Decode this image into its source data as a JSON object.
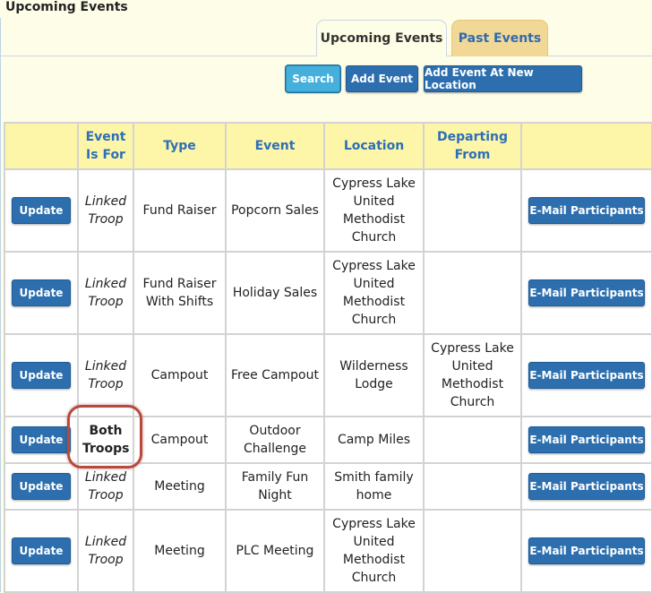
{
  "page": {
    "title": "Upcoming Events"
  },
  "tabs": [
    {
      "label": "Upcoming Events",
      "active": true
    },
    {
      "label": "Past Events",
      "active": false
    }
  ],
  "toolbar": {
    "search_label": "Search",
    "add_event_label": "Add Event",
    "add_event_new_location_label": "Add Event At New Location"
  },
  "table": {
    "headers": {
      "event_is_for": [
        "Event",
        "Is For"
      ],
      "type": "Type",
      "event": "Event",
      "location": "Location",
      "departing_from": [
        "Departing",
        "From"
      ]
    },
    "rows": [
      {
        "update": "Update",
        "is_for": [
          "Linked",
          "Troop"
        ],
        "type": [
          "Fund Raiser"
        ],
        "event": [
          "Popcorn Sales"
        ],
        "location": [
          "Cypress Lake",
          "United",
          "Methodist",
          "Church"
        ],
        "departing": [],
        "email": "E-Mail Participants"
      },
      {
        "update": "Update",
        "is_for": [
          "Linked",
          "Troop"
        ],
        "type": [
          "Fund Raiser",
          "With Shifts"
        ],
        "event": [
          "Holiday Sales"
        ],
        "location": [
          "Cypress Lake",
          "United",
          "Methodist",
          "Church"
        ],
        "departing": [],
        "email": "E-Mail Participants"
      },
      {
        "update": "Update",
        "is_for": [
          "Linked",
          "Troop"
        ],
        "type": [
          "Campout"
        ],
        "event": [
          "Free Campout"
        ],
        "location": [
          "Wilderness",
          "Lodge"
        ],
        "departing": [
          "Cypress Lake",
          "United",
          "Methodist",
          "Church"
        ],
        "email": "E-Mail Participants"
      },
      {
        "update": "Update",
        "is_for": [
          "Both",
          "Troops"
        ],
        "type": [
          "Campout"
        ],
        "event": [
          "Outdoor",
          "Challenge"
        ],
        "location": [
          "Camp Miles"
        ],
        "departing": [],
        "email": "E-Mail Participants"
      },
      {
        "update": "Update",
        "is_for": [
          "Linked",
          "Troop"
        ],
        "type": [
          "Meeting"
        ],
        "event": [
          "Family Fun",
          "Night"
        ],
        "location": [
          "Smith family",
          "home"
        ],
        "departing": [],
        "email": "E-Mail Participants"
      },
      {
        "update": "Update",
        "is_for": [
          "Linked",
          "Troop"
        ],
        "type": [
          "Meeting"
        ],
        "event": [
          "PLC Meeting"
        ],
        "location": [
          "Cypress Lake",
          "United",
          "Methodist",
          "Church"
        ],
        "departing": [],
        "email": "E-Mail Participants"
      }
    ]
  }
}
